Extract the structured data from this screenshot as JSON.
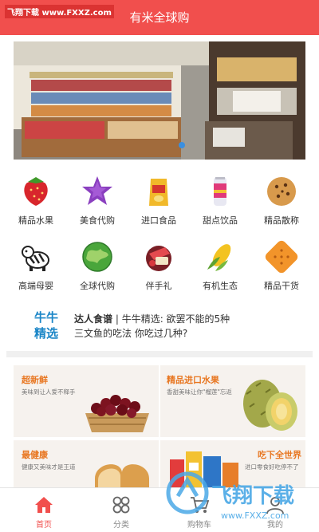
{
  "header": {
    "title": "有米全球购",
    "watermark": "飞翔下载 www.FXXZ.com"
  },
  "categories": [
    {
      "label": "精品水果",
      "icon": "strawberry-icon"
    },
    {
      "label": "美食代购",
      "icon": "star-candy-icon"
    },
    {
      "label": "进口食品",
      "icon": "snack-bag-icon"
    },
    {
      "label": "甜点饮品",
      "icon": "drink-can-icon"
    },
    {
      "label": "精品散称",
      "icon": "cookie-icon"
    },
    {
      "label": "高端母婴",
      "icon": "zebra-toy-icon"
    },
    {
      "label": "全球代购",
      "icon": "globe-icon"
    },
    {
      "label": "伴手礼",
      "icon": "gift-box-icon"
    },
    {
      "label": "有机生态",
      "icon": "corn-icon"
    },
    {
      "label": "精品干货",
      "icon": "cracker-icon"
    }
  ],
  "news": {
    "logo_top": "牛牛",
    "logo_bottom": "精选",
    "line1_bold": "达人食谱",
    "line1_rest": " | 牛牛精选: 欲罢不能的5种",
    "line2": "三文鱼的吃法 你吃过几种?"
  },
  "promos": [
    {
      "title": "超新鲜",
      "subtitle": "美味到让人爱不释手"
    },
    {
      "title": "精品进口水果",
      "subtitle": "香甜美味让你\"榴莲\"忘返"
    },
    {
      "title": "最健康",
      "subtitle": "健康又美味才是王道"
    },
    {
      "title": "吃下全世界",
      "subtitle": "进口零食好吃停不了"
    }
  ],
  "tabbar": [
    {
      "label": "首页",
      "active": true
    },
    {
      "label": "分类",
      "active": false
    },
    {
      "label": "购物车",
      "active": false
    },
    {
      "label": "我的",
      "active": false
    }
  ],
  "watermark_br": {
    "brand": "飞翔下载",
    "url": "www.FXXZ.com"
  },
  "colors": {
    "brand_red": "#f14f4d",
    "accent_orange": "#e87722",
    "news_blue": "#1b86c7"
  }
}
